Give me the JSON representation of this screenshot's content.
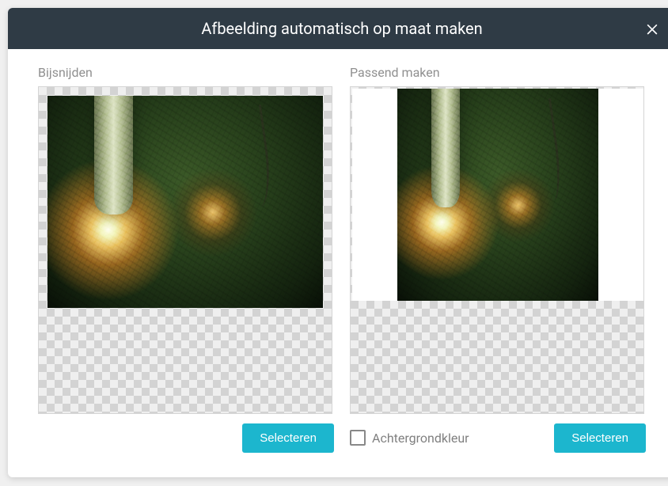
{
  "dialog": {
    "title": "Afbeelding automatisch op maat maken"
  },
  "crop": {
    "label": "Bijsnijden",
    "select": "Selecteren"
  },
  "fit": {
    "label": "Passend maken",
    "bg_color_label": "Achtergrondkleur",
    "bg_color_checked": false,
    "select": "Selecteren"
  },
  "icons": {
    "close": "close-icon"
  },
  "colors": {
    "accent": "#1cb6ce",
    "header_bg": "#2f3b45"
  }
}
